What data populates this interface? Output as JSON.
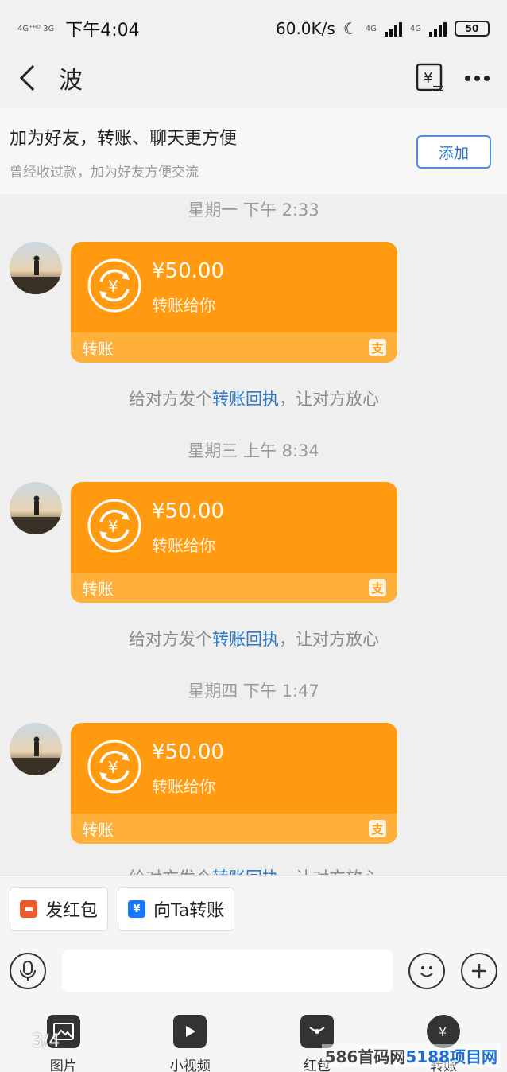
{
  "status_bar": {
    "time": "下午4:04",
    "network_speed": "60.0K/s",
    "signal_label_1": "4G",
    "signal_label_2": "4G",
    "battery": "50",
    "top_overlay": "4G⁺ᴴᴰ 3G"
  },
  "nav": {
    "title": "波"
  },
  "add_friend_banner": {
    "title": "加为好友，转账、聊天更方便",
    "subtitle": "曾经收过款，加为好友方便交流",
    "button_label": "添加"
  },
  "messages": [
    {
      "time": "星期一 下午 2:33",
      "amount": "¥50.00",
      "desc": "转账给你",
      "footer_label": "转账",
      "hint_prefix": "给对方发个",
      "hint_link": "转账回执",
      "hint_suffix": "，让对方放心"
    },
    {
      "time": "星期三 上午 8:34",
      "amount": "¥50.00",
      "desc": "转账给你",
      "footer_label": "转账",
      "hint_prefix": "给对方发个",
      "hint_link": "转账回执",
      "hint_suffix": "，让对方放心"
    },
    {
      "time": "星期四 下午 1:47",
      "amount": "¥50.00",
      "desc": "转账给你",
      "footer_label": "转账",
      "hint_prefix": "给对方发个",
      "hint_link": "转账回执",
      "hint_suffix": "，让对方放心"
    }
  ],
  "quick_actions": [
    {
      "label": "发红包",
      "icon": "red-packet-icon",
      "color": "#f05a28"
    },
    {
      "label": "向Ta转账",
      "icon": "transfer-icon",
      "color": "#1677ff"
    }
  ],
  "input": {
    "placeholder": ""
  },
  "tools": [
    {
      "label": "图片",
      "icon": "image-icon"
    },
    {
      "label": "小视频",
      "icon": "video-icon"
    },
    {
      "label": "红包",
      "icon": "red-packet-icon"
    },
    {
      "label": "转账",
      "icon": "transfer-icon"
    }
  ],
  "overlay": {
    "page_counter": "3/4",
    "watermark_prefix": "586首码网",
    "watermark_highlight": "5188项目网"
  },
  "colors": {
    "card_orange": "#ff9a11",
    "card_footer": "#ffb03a",
    "link_blue": "#2e78c8"
  }
}
